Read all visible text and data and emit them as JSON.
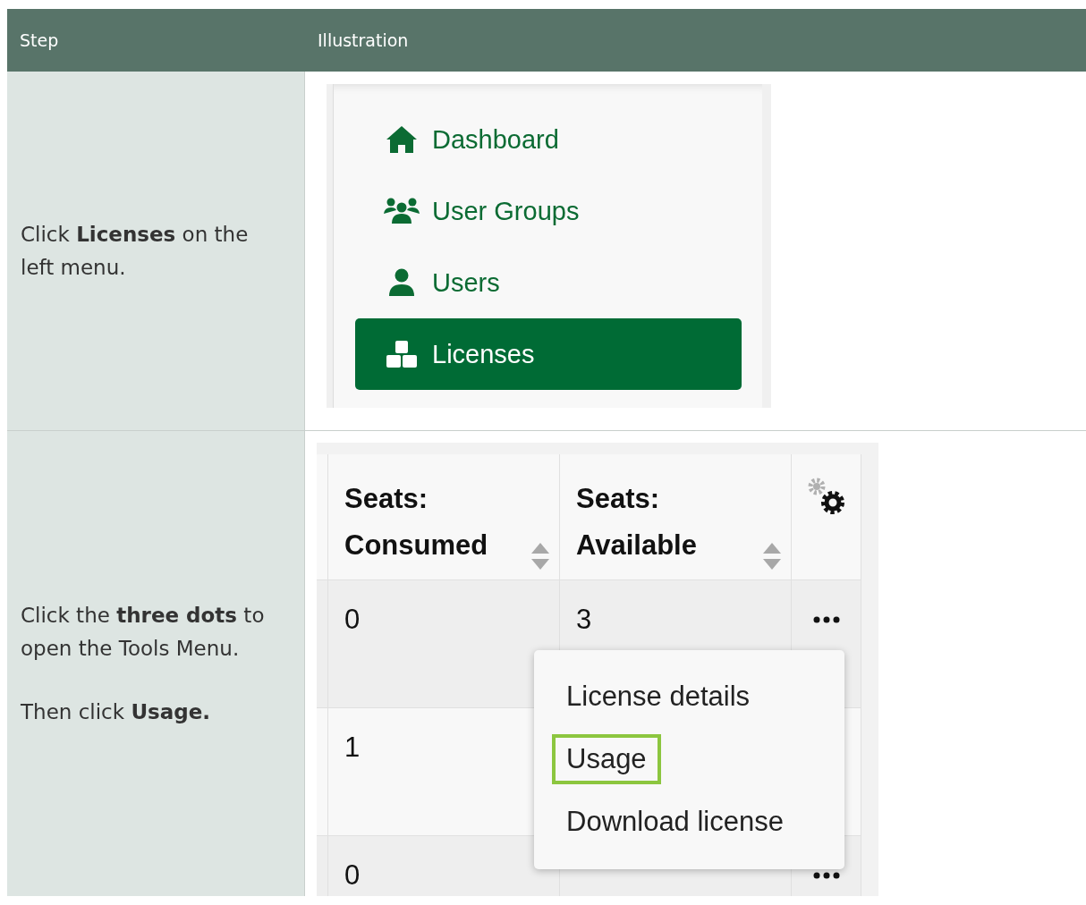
{
  "table": {
    "columns": [
      "Step",
      "Illustration"
    ],
    "rows": [
      {
        "kind": "menu",
        "step": [
          "Click **Licenses** on the left menu."
        ],
        "menu": [
          {
            "label": "Dashboard",
            "selected": false
          },
          {
            "label": "User Groups",
            "selected": false
          },
          {
            "label": "Users",
            "selected": false
          },
          {
            "label": "Licenses",
            "selected": true
          }
        ]
      },
      {
        "kind": "grid",
        "step": [
          "Click the **three dots** to open the Tools Menu.",
          "Then click **Usage.**"
        ],
        "grid": {
          "columns": [
            {
              "label": "Seats: Consumed"
            },
            {
              "label": "Seats: Available"
            }
          ],
          "rows": [
            {
              "cells": [
                "0",
                "3"
              ]
            },
            {
              "cells": [
                "1"
              ]
            },
            {
              "cells": [
                "0"
              ]
            }
          ],
          "popup": [
            {
              "label": "License details",
              "highlighted": false
            },
            {
              "label": "Usage",
              "highlighted": true
            },
            {
              "label": "Download license",
              "highlighted": false
            }
          ]
        }
      }
    ]
  }
}
